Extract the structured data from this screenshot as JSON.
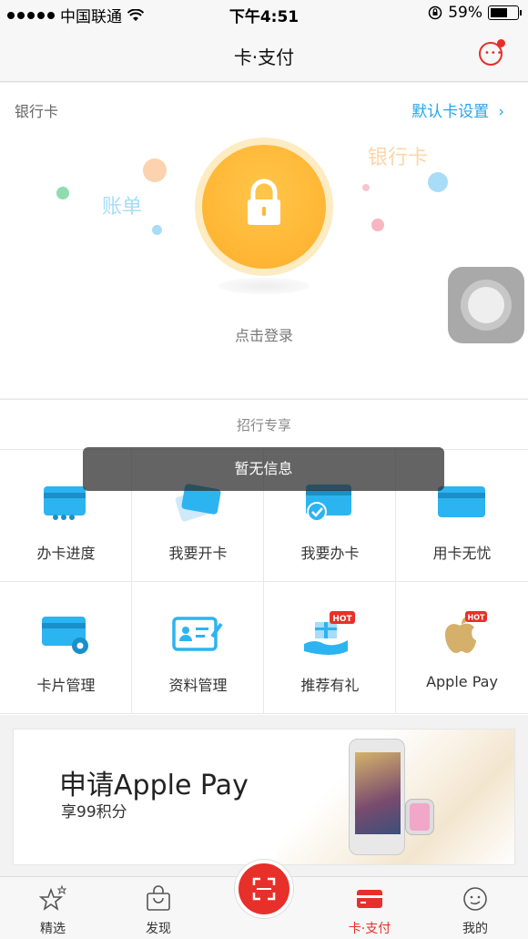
{
  "status_bar": {
    "carrier": "中国联通",
    "time": "下午4:51",
    "battery": "59%"
  },
  "nav": {
    "title": "卡·支付"
  },
  "bank_card": {
    "section_label": "银行卡",
    "default_link": "默认卡设置",
    "float_bill": "账单",
    "float_card": "银行卡",
    "login_text": "点击登录"
  },
  "exclusive": {
    "title": "招行专享",
    "items": [
      {
        "label": "办卡进度"
      },
      {
        "label": "我要开卡"
      },
      {
        "label": "我要办卡"
      },
      {
        "label": "用卡无忧"
      },
      {
        "label": "卡片管理"
      },
      {
        "label": "资料管理"
      },
      {
        "label": "推荐有礼",
        "badge": "HOT"
      },
      {
        "label": "Apple Pay",
        "badge": "HOT"
      }
    ]
  },
  "toast": {
    "text": "暂无信息"
  },
  "banner": {
    "title": "申请Apple Pay",
    "subtitle": "享99积分"
  },
  "tab_bar": {
    "items": [
      {
        "label": "精选"
      },
      {
        "label": "发现"
      },
      {
        "label": "卡·支付"
      },
      {
        "label": "我的"
      }
    ],
    "active": "卡·支付"
  },
  "colors": {
    "accent_red": "#e8302a",
    "link_blue": "#2aa4e8",
    "lock_yellow": "#ffb835",
    "card_blue": "#2cb4f0"
  }
}
